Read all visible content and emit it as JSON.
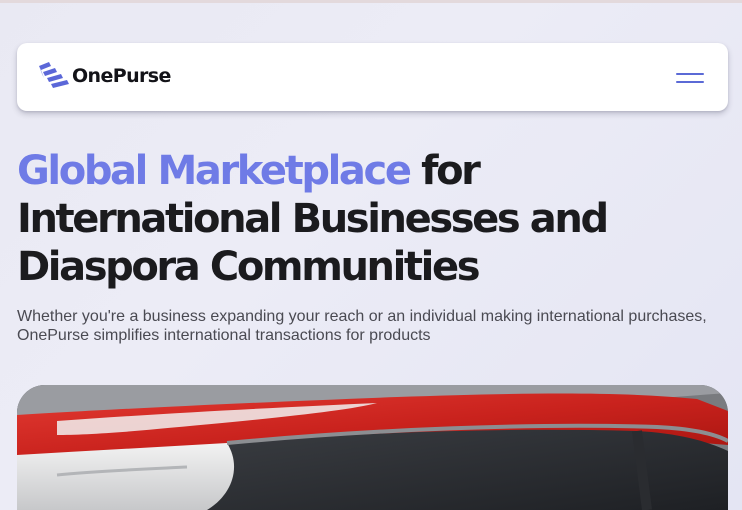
{
  "brand": {
    "name": "OnePurse",
    "accent_color": "#6f7be6",
    "logo_icon": "onepurse-chevrons-logo"
  },
  "nav": {
    "menu_icon": "hamburger-menu-icon"
  },
  "hero": {
    "title_accent": "Global Marketplace",
    "title_rest_line1": " for",
    "title_line2": "International Businesses and",
    "title_line3": "Diaspora Communities",
    "subtitle": "Whether you're a business expanding your reach or an individual making international purchases, OnePurse simplifies international transactions for products",
    "image": "red car door close-up photo"
  }
}
